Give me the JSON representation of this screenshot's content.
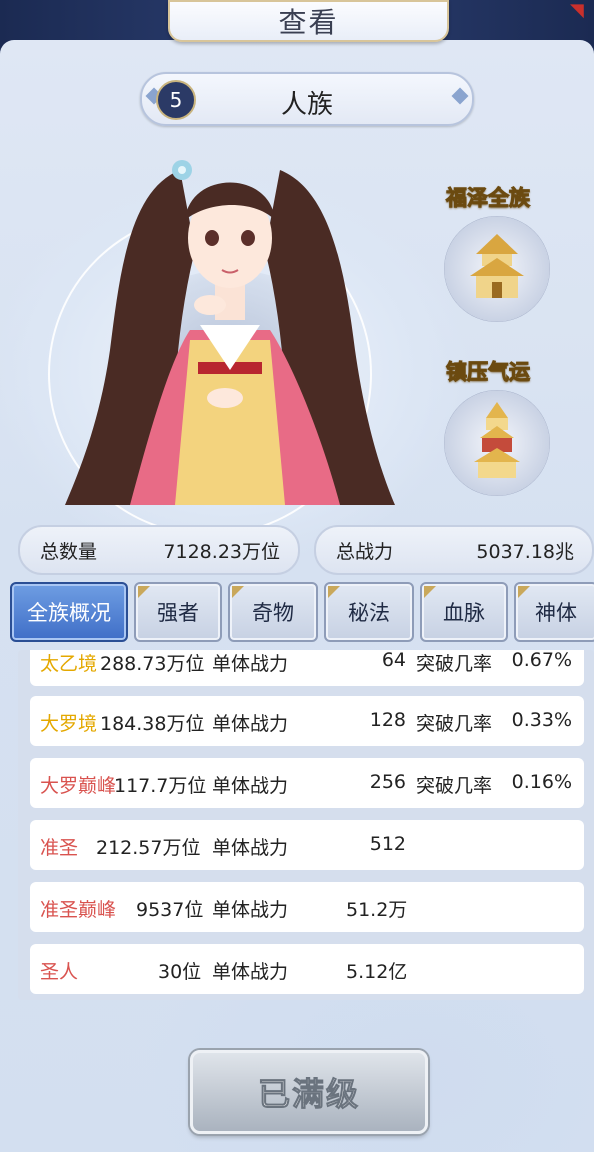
{
  "header": {
    "title": "查看"
  },
  "race": {
    "level": "5",
    "name": "人族"
  },
  "buffs": [
    {
      "label": "福泽全族",
      "icon": "pagoda-tower-icon"
    },
    {
      "label": "镇压气运",
      "icon": "golden-pagoda-icon"
    }
  ],
  "stats": {
    "total_count_label": "总数量",
    "total_count_value": "7128.23万位",
    "total_power_label": "总战力",
    "total_power_value": "5037.18兆"
  },
  "tabs": [
    "全族概况",
    "强者",
    "奇物",
    "秘法",
    "血脉",
    "神体"
  ],
  "rows": [
    {
      "rank": "太乙境",
      "count": "288.73万位",
      "power_label": "单体战力",
      "power": "64",
      "chance_label": "突破几率",
      "chance": "0.67%"
    },
    {
      "rank": "大罗境",
      "count": "184.38万位",
      "power_label": "单体战力",
      "power": "128",
      "chance_label": "突破几率",
      "chance": "0.33%"
    },
    {
      "rank": "大罗巅峰",
      "count": "117.7万位",
      "power_label": "单体战力",
      "power": "256",
      "chance_label": "突破几率",
      "chance": "0.16%"
    },
    {
      "rank": "准圣",
      "count": "212.57万位",
      "power_label": "单体战力",
      "power": "512",
      "chance_label": "",
      "chance": ""
    },
    {
      "rank": "准圣巅峰",
      "count": "9537位",
      "power_label": "单体战力",
      "power": "51.2万",
      "chance_label": "",
      "chance": ""
    },
    {
      "rank": "圣人",
      "count": "30位",
      "power_label": "单体战力",
      "power": "5.12亿",
      "chance_label": "",
      "chance": ""
    }
  ],
  "button": {
    "label": "已满级"
  },
  "colors": {
    "gold_rank": "#e4a800",
    "red_rank": "#d9534f",
    "active_tab": "#3f6ec7"
  }
}
